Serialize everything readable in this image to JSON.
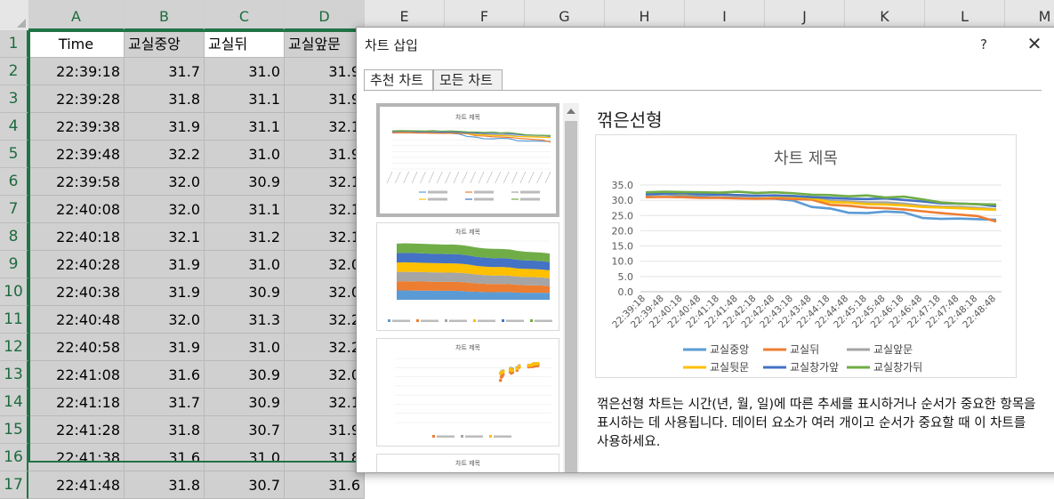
{
  "spreadsheet": {
    "columns": [
      "A",
      "B",
      "C",
      "D",
      "E",
      "F",
      "G",
      "H",
      "I",
      "J",
      "K",
      "L",
      "M"
    ],
    "headers": [
      "Time",
      "교실중앙",
      "교실뒤",
      "교실앞문"
    ],
    "rows": [
      [
        "22:39:18",
        "31.7",
        "31.0",
        "31.9"
      ],
      [
        "22:39:28",
        "31.8",
        "31.1",
        "31.9"
      ],
      [
        "22:39:38",
        "31.9",
        "31.1",
        "32.1"
      ],
      [
        "22:39:48",
        "32.2",
        "31.0",
        "31.9"
      ],
      [
        "22:39:58",
        "32.0",
        "30.9",
        "32.1"
      ],
      [
        "22:40:08",
        "32.0",
        "31.1",
        "32.1"
      ],
      [
        "22:40:18",
        "32.1",
        "31.2",
        "32.1"
      ],
      [
        "22:40:28",
        "31.9",
        "31.0",
        "32.0"
      ],
      [
        "22:40:38",
        "31.9",
        "30.9",
        "32.0"
      ],
      [
        "22:40:48",
        "32.0",
        "31.3",
        "32.2"
      ],
      [
        "22:40:58",
        "31.9",
        "31.0",
        "32.2"
      ],
      [
        "22:41:08",
        "31.6",
        "30.9",
        "32.0"
      ],
      [
        "22:41:18",
        "31.7",
        "30.9",
        "32.1"
      ],
      [
        "22:41:28",
        "31.8",
        "30.7",
        "31.9"
      ],
      [
        "22:41:38",
        "31.6",
        "31.0",
        "31.8"
      ],
      [
        "22:41:48",
        "31.8",
        "30.7",
        "31.6"
      ]
    ]
  },
  "dialog": {
    "title": "차트 삽입",
    "help": "?",
    "close": "✕",
    "tabs": [
      "추천 차트",
      "모든 차트"
    ],
    "thumbnail_title": "차트 제목",
    "preview_heading": "꺾은선형",
    "description": "꺾은선형 차트는 시간(년, 월, 일)에 따른 추세를 표시하거나 순서가 중요한 항목을 표시하는 데 사용됩니다. 데이터 요소가 여러 개이고 순서가 중요할 때 이 차트를 사용하세요."
  },
  "chart_data": {
    "type": "line",
    "title": "차트 제목",
    "ylim": [
      0,
      35
    ],
    "yticks": [
      "0.0",
      "5.0",
      "10.0",
      "15.0",
      "20.0",
      "25.0",
      "30.0",
      "35.0"
    ],
    "x": [
      "22:39:18",
      "22:39:48",
      "22:40:18",
      "22:40:48",
      "22:41:18",
      "22:41:48",
      "22:42:18",
      "22:42:48",
      "22:43:18",
      "22:43:48",
      "22:44:18",
      "22:44:48",
      "22:45:18",
      "22:45:48",
      "22:46:18",
      "22:46:48",
      "22:47:18",
      "22:47:48",
      "22:48:18",
      "22:48:48"
    ],
    "series": [
      {
        "name": "교실중앙",
        "color": "#5b9bd5",
        "values": [
          31.7,
          32.0,
          31.6,
          31.2,
          30.9,
          30.8,
          30.6,
          30.5,
          29.9,
          27.8,
          27.3,
          25.9,
          25.8,
          26.3,
          26.0,
          24.2,
          23.9,
          24.0,
          23.8,
          23.6
        ]
      },
      {
        "name": "교실뒤",
        "color": "#ed7d31",
        "values": [
          31.0,
          31.1,
          31.0,
          30.8,
          30.8,
          30.6,
          30.5,
          30.6,
          30.4,
          30.2,
          28.5,
          28.2,
          27.6,
          27.4,
          27.0,
          26.4,
          25.8,
          25.3,
          24.8,
          23.0
        ]
      },
      {
        "name": "교실앞문",
        "color": "#a5a5a5",
        "values": [
          31.9,
          32.1,
          32.1,
          32.2,
          32.0,
          31.6,
          31.5,
          31.4,
          31.3,
          31.0,
          30.0,
          29.6,
          29.3,
          29.3,
          28.9,
          28.2,
          27.9,
          27.8,
          27.5,
          27.0
        ]
      },
      {
        "name": "교실뒷문",
        "color": "#ffc000",
        "values": [
          32.2,
          32.3,
          32.1,
          32.0,
          31.8,
          31.6,
          31.5,
          31.4,
          31.2,
          30.7,
          29.4,
          29.2,
          28.7,
          28.6,
          28.3,
          27.8,
          27.6,
          27.4,
          27.1,
          26.9
        ]
      },
      {
        "name": "교실창가앞",
        "color": "#4472c4",
        "values": [
          32.0,
          32.2,
          32.3,
          32.0,
          31.8,
          31.7,
          31.5,
          31.6,
          31.4,
          31.0,
          30.8,
          30.5,
          30.4,
          30.6,
          30.1,
          29.6,
          29.0,
          28.9,
          28.7,
          28.0
        ]
      },
      {
        "name": "교실창가뒤",
        "color": "#70ad47",
        "values": [
          32.6,
          32.8,
          32.7,
          32.6,
          32.5,
          32.8,
          32.4,
          32.6,
          32.3,
          31.8,
          31.7,
          31.3,
          31.6,
          30.9,
          31.2,
          30.3,
          29.3,
          28.9,
          28.7,
          28.6
        ]
      }
    ],
    "legend_position": "bottom"
  }
}
